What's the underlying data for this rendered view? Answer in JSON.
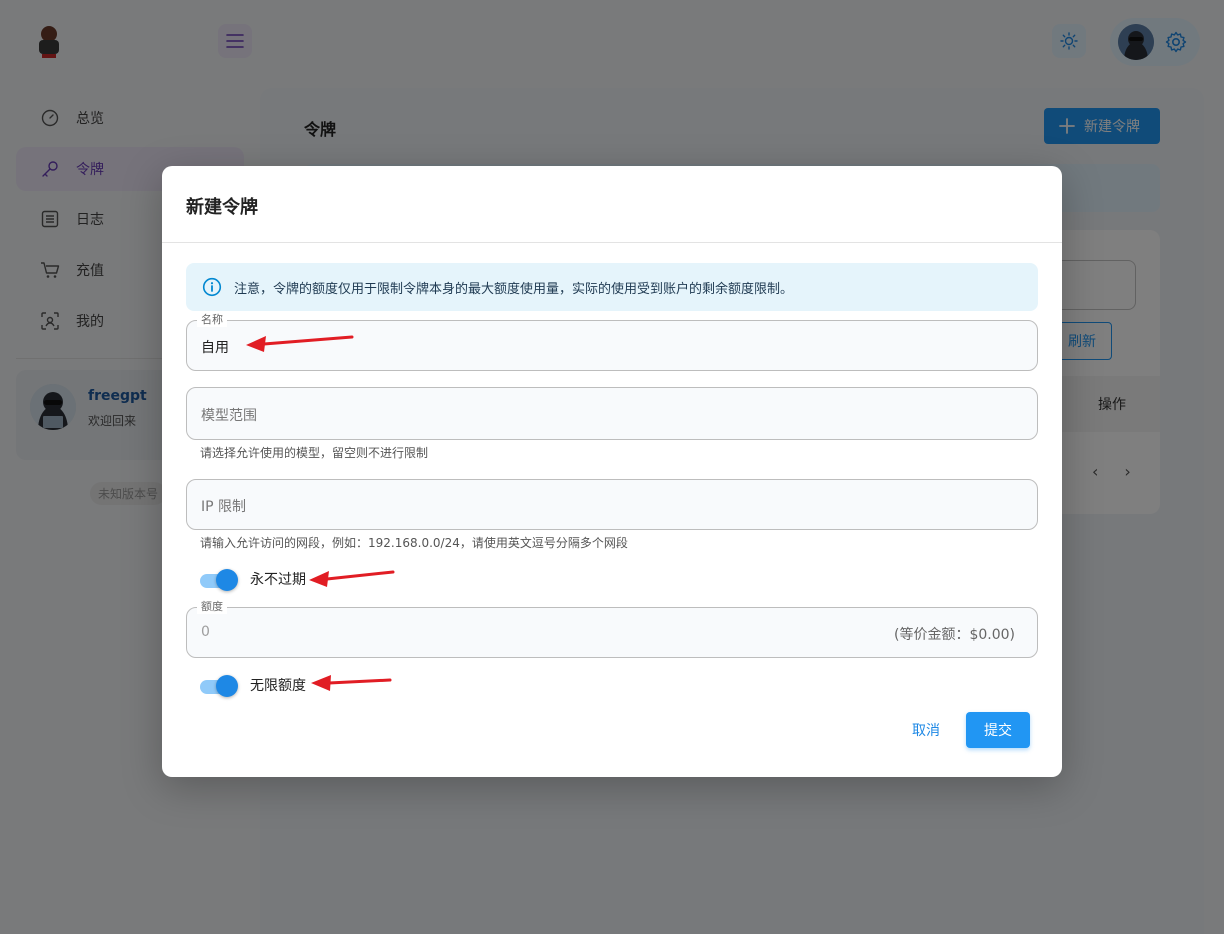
{
  "nav": [
    {
      "label": "总览",
      "icon": "dashboard-icon"
    },
    {
      "label": "令牌",
      "icon": "key-icon",
      "active": true
    },
    {
      "label": "日志",
      "icon": "list-icon"
    },
    {
      "label": "充值",
      "icon": "cart-icon"
    },
    {
      "label": "我的",
      "icon": "face-scan-icon"
    }
  ],
  "user": {
    "name": "freegpt",
    "welcome": "欢迎回来"
  },
  "version": "未知版本号",
  "page": {
    "title": "令牌",
    "new_button": "新建令牌",
    "refresh": "刷新",
    "actions_header": "操作"
  },
  "dialog": {
    "title": "新建令牌",
    "notice": "注意，令牌的额度仅用于限制令牌本身的最大额度使用量，实际的使用受到账户的剩余额度限制。",
    "name_label": "名称",
    "name_value": "自用",
    "models_placeholder": "模型范围",
    "models_helper": "请选择允许使用的模型，留空则不进行限制",
    "ip_placeholder": "IP 限制",
    "ip_helper": "请输入允许访问的网段，例如：192.168.0.0/24，请使用英文逗号分隔多个网段",
    "never_expire_label": "永不过期",
    "never_expire_on": true,
    "quota_label": "额度",
    "quota_value": "0",
    "quota_suffix": "(等价金额：$0.00)",
    "unlimited_label": "无限额度",
    "unlimited_on": true,
    "cancel": "取消",
    "submit": "提交"
  },
  "colors": {
    "primary": "#2196f3",
    "accent_purple": "#673ab7",
    "annotation_red": "#e11d24"
  }
}
